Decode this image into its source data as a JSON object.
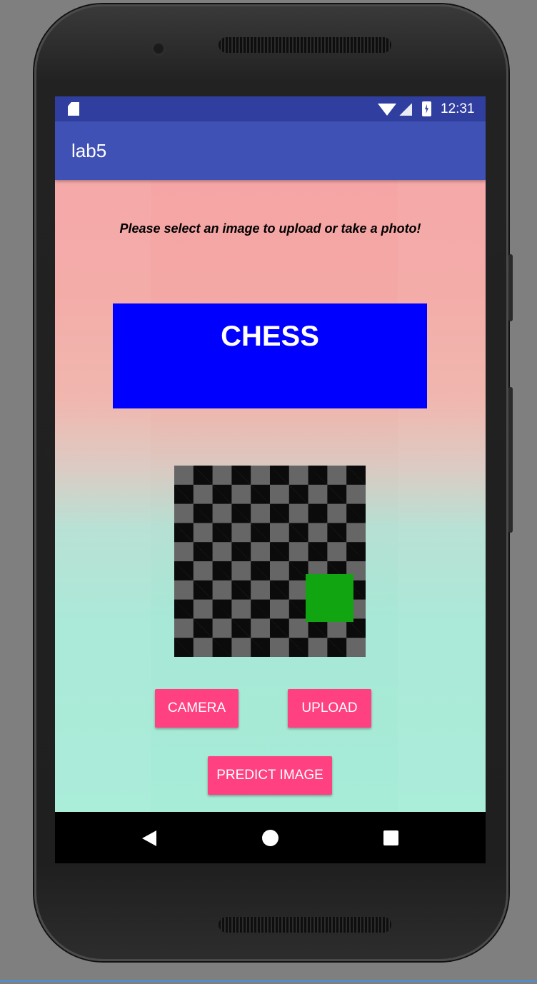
{
  "status_bar": {
    "time": "12:31"
  },
  "app_bar": {
    "title": "lab5"
  },
  "main": {
    "prompt": "Please select an image to upload or take a photo!",
    "result_label": "CHESS",
    "buttons": {
      "camera": "CAMERA",
      "upload": "UPLOAD",
      "predict": "PREDICT IMAGE"
    }
  },
  "colors": {
    "status_bar": "#303f9f",
    "app_bar": "#3f51b5",
    "accent": "#ff4081",
    "result_box": "#0000ff",
    "piece": "#11a511"
  },
  "icons": {
    "sd_card": "sd-card-icon",
    "wifi": "wifi-icon",
    "signal": "signal-icon",
    "battery": "battery-charging-icon",
    "back": "back-icon",
    "home": "home-icon",
    "recents": "recents-icon"
  }
}
